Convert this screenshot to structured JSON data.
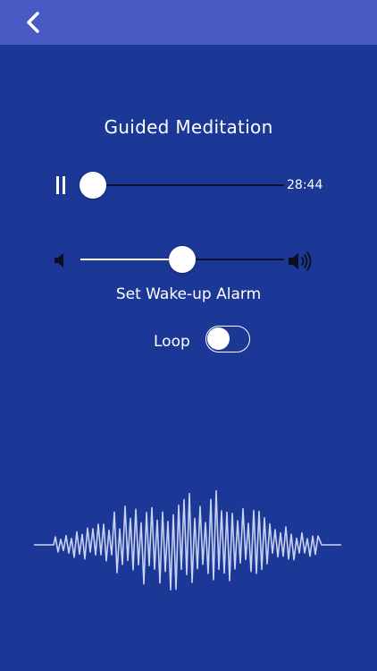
{
  "header": {
    "back_icon": "chevron-left-icon",
    "bar_color": "#4a5ac4"
  },
  "title": "Guided Meditation",
  "player": {
    "pause_icon": "pause-icon",
    "progress": 0.06,
    "time_label": "28:44"
  },
  "volume": {
    "low_icon": "speaker-low-icon",
    "high_icon": "speaker-high-icon",
    "level": 0.5
  },
  "alarm": {
    "label": "Set Wake-up Alarm"
  },
  "loop": {
    "label": "Loop",
    "enabled": false
  },
  "waveform": {
    "icon": "waveform-graphic"
  },
  "colors": {
    "background": "#1c3896",
    "header": "#4a5ac4",
    "foreground": "#ffffff",
    "waveform": "#c8d2f2"
  }
}
